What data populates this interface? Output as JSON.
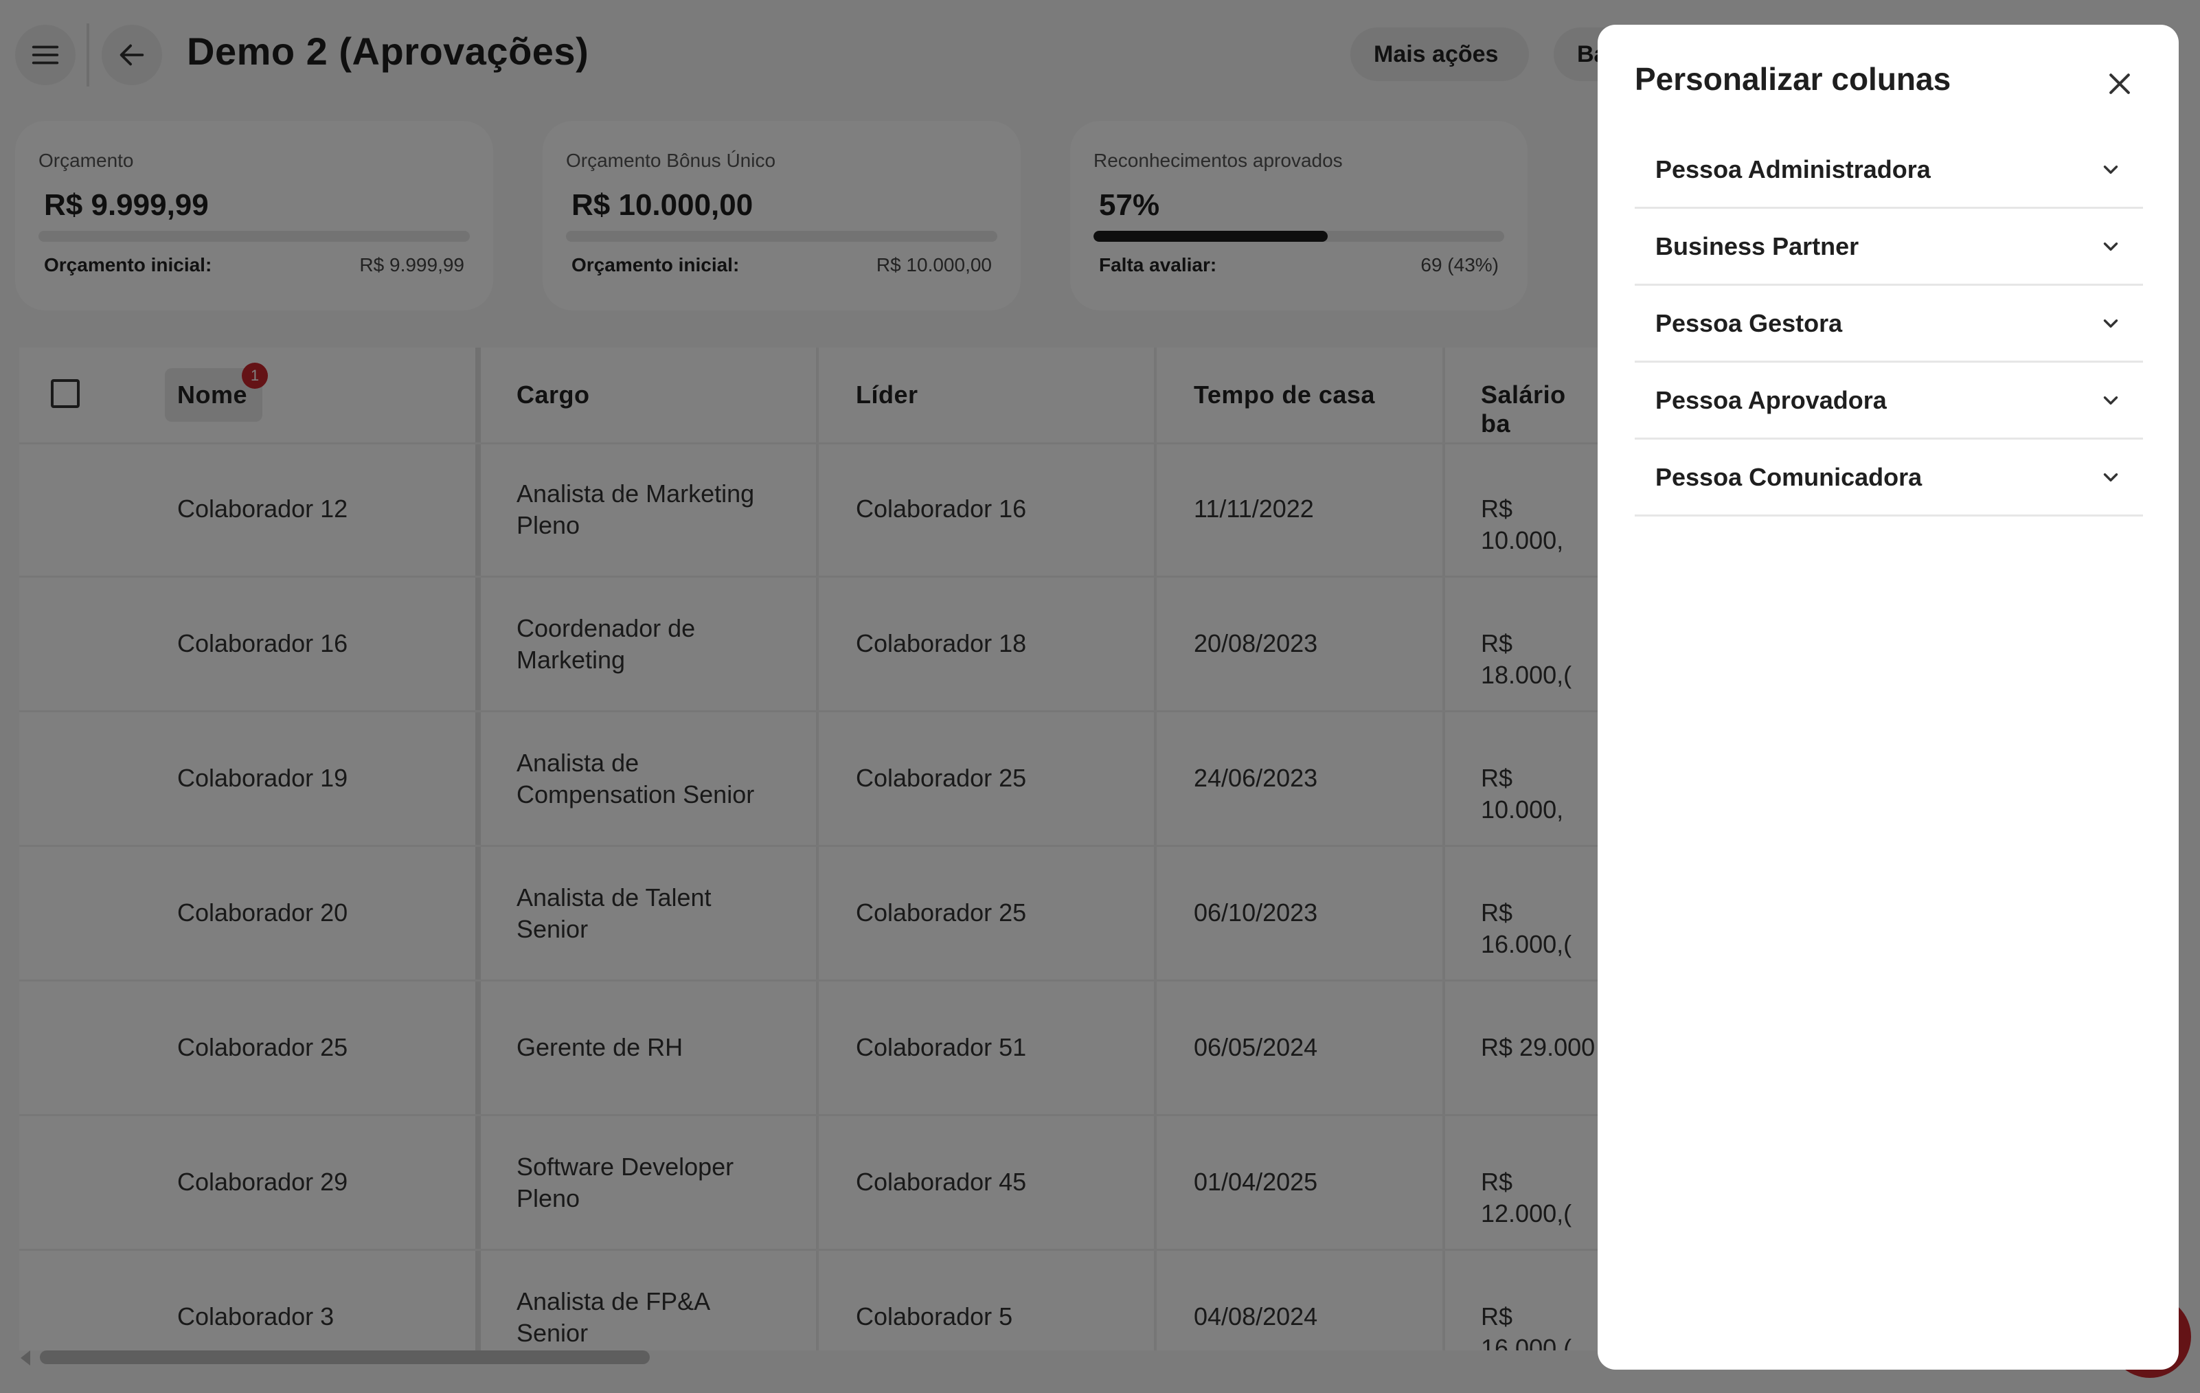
{
  "header": {
    "title": "Demo 2 (Aprovações)",
    "actions": [
      "Mais ações",
      "Ba"
    ]
  },
  "cards": [
    {
      "label": "Orçamento",
      "value": "R$ 9.999,99",
      "progress": 0,
      "foot_label": "Orçamento inicial:",
      "foot_value": "R$ 9.999,99"
    },
    {
      "label": "Orçamento Bônus Único",
      "value": "R$ 10.000,00",
      "progress": 0,
      "foot_label": "Orçamento inicial:",
      "foot_value": "R$ 10.000,00"
    },
    {
      "label": "Reconhecimentos aprovados",
      "value": "57%",
      "progress": 0.57,
      "foot_label": "Falta avaliar:",
      "foot_value": "69 (43%)"
    }
  ],
  "table": {
    "badge_count": "1",
    "columns": [
      "Nome",
      "Cargo",
      "Líder",
      "Tempo de casa",
      "Salário ba"
    ],
    "rows": [
      {
        "nome": "Colaborador 12",
        "cargo": [
          "Analista de Marketing",
          "Pleno"
        ],
        "lider": "Colaborador 16",
        "tempo": "11/11/2022",
        "salario": "R$ 10.000,"
      },
      {
        "nome": "Colaborador 16",
        "cargo": [
          "Coordenador de",
          "Marketing"
        ],
        "lider": "Colaborador 18",
        "tempo": "20/08/2023",
        "salario": "R$ 18.000,("
      },
      {
        "nome": "Colaborador 19",
        "cargo": [
          "Analista de",
          "Compensation Senior"
        ],
        "lider": "Colaborador 25",
        "tempo": "24/06/2023",
        "salario": "R$ 10.000,"
      },
      {
        "nome": "Colaborador 20",
        "cargo": [
          "Analista de Talent",
          "Senior"
        ],
        "lider": "Colaborador 25",
        "tempo": "06/10/2023",
        "salario": "R$ 16.000,("
      },
      {
        "nome": "Colaborador 25",
        "cargo": [
          "Gerente de RH",
          ""
        ],
        "lider": "Colaborador 51",
        "tempo": "06/05/2024",
        "salario": "R$ 29.000"
      },
      {
        "nome": "Colaborador 29",
        "cargo": [
          "Software Developer",
          "Pleno"
        ],
        "lider": "Colaborador 45",
        "tempo": "01/04/2025",
        "salario": "R$ 12.000,("
      },
      {
        "nome": "Colaborador 3",
        "cargo": [
          "Analista de FP&A",
          "Senior"
        ],
        "lider": "Colaborador 5",
        "tempo": "04/08/2024",
        "salario": "R$ 16.000,("
      }
    ]
  },
  "drawer": {
    "title": "Personalizar colunas",
    "sections": [
      "Pessoa Administradora",
      "Business Partner",
      "Pessoa Gestora",
      "Pessoa Aprovadora",
      "Pessoa Comunicadora"
    ]
  },
  "icons": {
    "menu": "menu-icon",
    "back": "arrow-left-icon",
    "close": "close-icon",
    "expand": "chevron-down-icon"
  },
  "colors": {
    "accent_red": "#c9262c",
    "overlay": "rgba(0,0,0,0.5)",
    "progress_fill": "#1d1d1d"
  }
}
